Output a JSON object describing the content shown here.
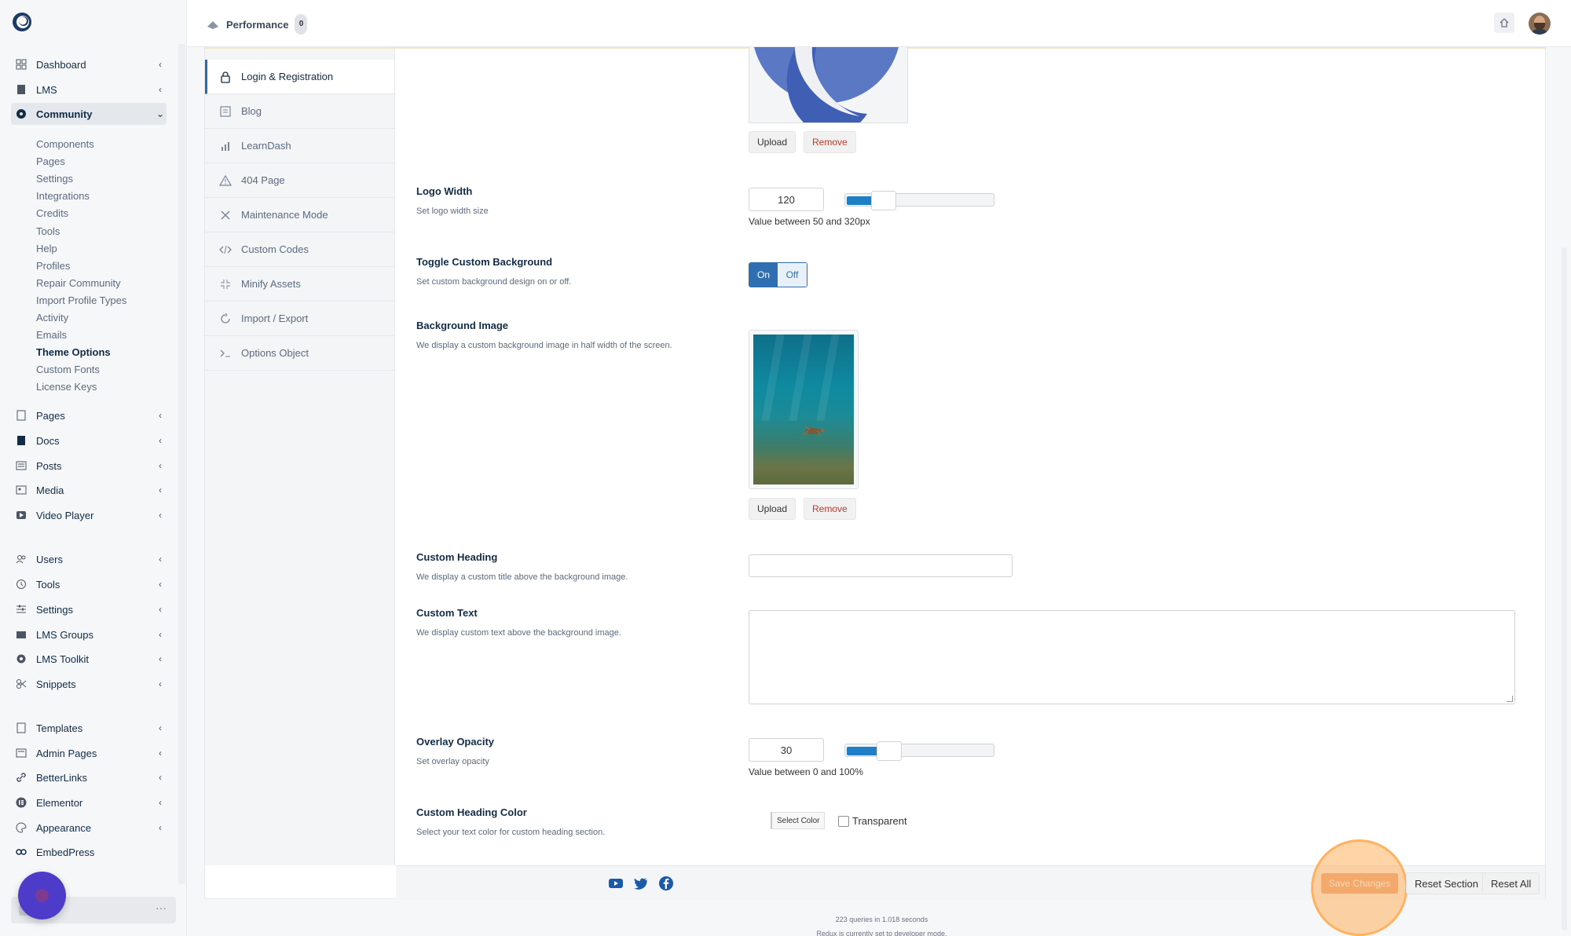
{
  "sidebar": {
    "menu": [
      {
        "label": "Dashboard",
        "icon": "dashboard-icon"
      },
      {
        "label": "LMS",
        "icon": "book-icon"
      },
      {
        "label": "Community",
        "icon": "community-icon"
      },
      {
        "label": "Pages",
        "icon": "page-icon"
      },
      {
        "label": "Docs",
        "icon": "docs-icon"
      },
      {
        "label": "Posts",
        "icon": "posts-icon"
      },
      {
        "label": "Media",
        "icon": "media-icon"
      },
      {
        "label": "Video Player",
        "icon": "video-icon"
      },
      {
        "label": "Users",
        "icon": "users-icon"
      },
      {
        "label": "Tools",
        "icon": "tools-icon"
      },
      {
        "label": "Settings",
        "icon": "settings-icon"
      },
      {
        "label": "LMS Groups",
        "icon": "groups-icon"
      },
      {
        "label": "LMS Toolkit",
        "icon": "toolkit-icon"
      },
      {
        "label": "Snippets",
        "icon": "snippets-icon"
      },
      {
        "label": "Templates",
        "icon": "templates-icon"
      },
      {
        "label": "Admin Pages",
        "icon": "admin-pages-icon"
      },
      {
        "label": "BetterLinks",
        "icon": "link-icon"
      },
      {
        "label": "Elementor",
        "icon": "elementor-icon"
      },
      {
        "label": "Appearance",
        "icon": "appearance-icon"
      },
      {
        "label": "EmbedPress",
        "icon": "embedpress-icon"
      }
    ],
    "submenu": [
      "Components",
      "Pages",
      "Settings",
      "Integrations",
      "Credits",
      "Tools",
      "Help",
      "Profiles",
      "Repair Community",
      "Import Profile Types",
      "Activity",
      "Emails",
      "Theme Options",
      "Custom Fonts",
      "License Keys"
    ],
    "current_submenu": "Theme Options"
  },
  "topbar": {
    "performance_label": "Performance",
    "performance_count": "0"
  },
  "tabs": [
    {
      "label": "Login & Registration",
      "icon": "lock-icon"
    },
    {
      "label": "Blog",
      "icon": "blog-icon"
    },
    {
      "label": "LearnDash",
      "icon": "bar-chart-icon"
    },
    {
      "label": "404 Page",
      "icon": "warning-icon"
    },
    {
      "label": "Maintenance Mode",
      "icon": "wrench-icon"
    },
    {
      "label": "Custom Codes",
      "icon": "code-icon"
    },
    {
      "label": "Minify Assets",
      "icon": "minify-icon"
    },
    {
      "label": "Import / Export",
      "icon": "refresh-icon"
    },
    {
      "label": "Options Object",
      "icon": "terminal-icon"
    }
  ],
  "fields": {
    "logo": {
      "upload": "Upload",
      "remove": "Remove"
    },
    "logo_width": {
      "title": "Logo Width",
      "desc": "Set logo width size",
      "value": "120",
      "slider_fraction": 0.26,
      "hint": "Value between 50 and 320px"
    },
    "toggle_bg": {
      "title": "Toggle Custom Background",
      "desc": "Set custom background design on or off.",
      "on": "On",
      "off": "Off",
      "selected": "On"
    },
    "bg_image": {
      "title": "Background Image",
      "desc": "We display a custom background image in half width of the screen.",
      "upload": "Upload",
      "remove": "Remove"
    },
    "custom_heading": {
      "title": "Custom Heading",
      "desc": "We display a custom title above the background image.",
      "value": ""
    },
    "custom_text": {
      "title": "Custom Text",
      "desc": "We display custom text above the background image.",
      "value": ""
    },
    "overlay_opacity": {
      "title": "Overlay Opacity",
      "desc": "Set overlay opacity",
      "value": "30",
      "slider_fraction": 0.3,
      "hint": "Value between 0 and 100%"
    },
    "heading_color": {
      "title": "Custom Heading Color",
      "desc": "Select your text color for custom heading section.",
      "select_color": "Select Color",
      "transparent": "Transparent",
      "transparent_checked": false
    }
  },
  "footer": {
    "save": "Save Changes",
    "reset_section": "Reset Section",
    "reset_all": "Reset All",
    "social": [
      "youtube-icon",
      "twitter-icon",
      "facebook-icon"
    ]
  },
  "stats": {
    "queries": "223 queries in 1.018 seconds",
    "redux": "Redux is currently set to developer mode."
  },
  "colors": {
    "accent": "#2f6fb1",
    "slider": "#1e7fc7",
    "remove": "#c0392b",
    "highlight": "#ffb05c"
  }
}
